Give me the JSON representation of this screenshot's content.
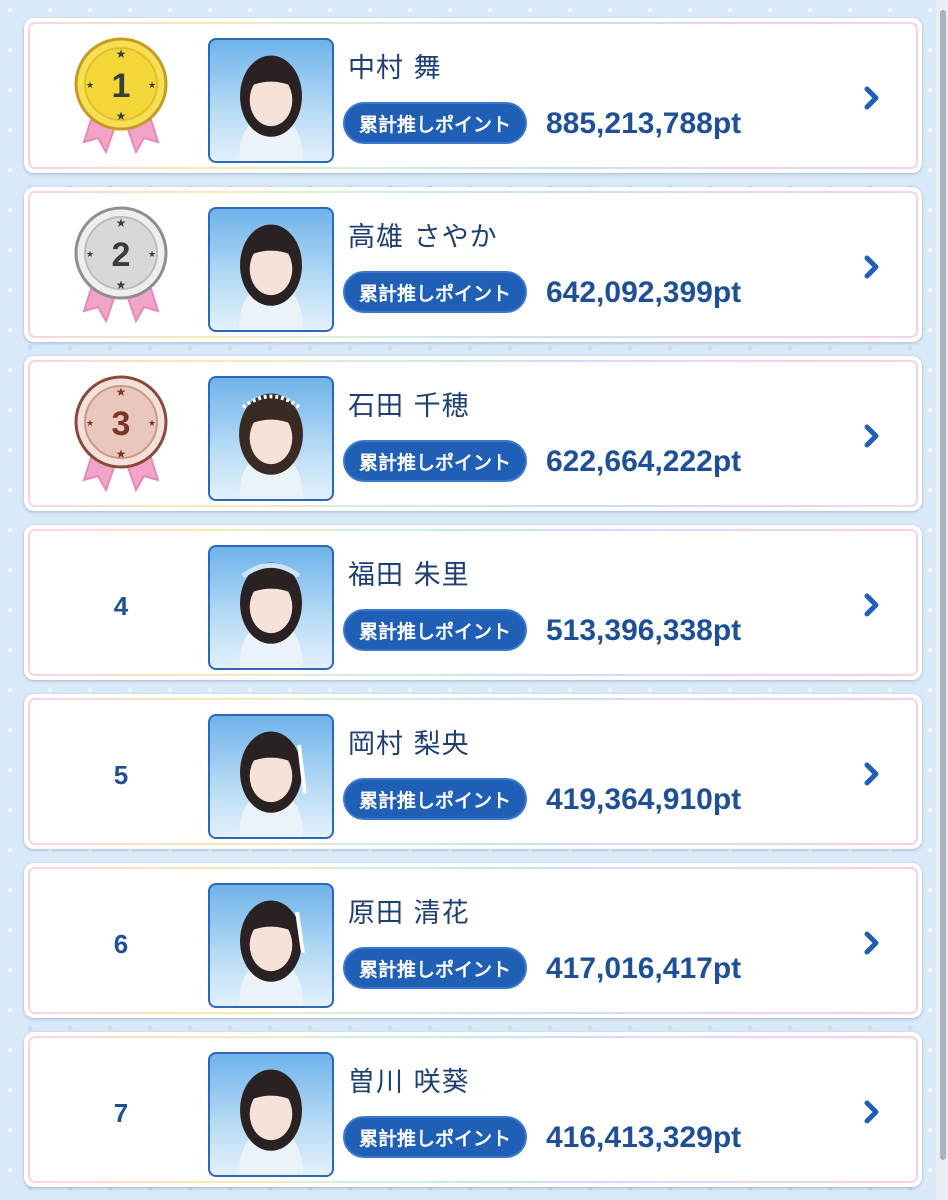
{
  "badge_label": "累計推しポイント",
  "colors": {
    "accent": "#1f5fb6",
    "text": "#1f4f97",
    "gold": "#f3d638",
    "silver": "#d8d8d8",
    "bronze": "#e9c7bd",
    "ribbon": "#f2a3c8"
  },
  "entries": [
    {
      "rank": "1",
      "name": "中村 舞",
      "points": "885,213,788pt",
      "medal": "gold"
    },
    {
      "rank": "2",
      "name": "高雄 さやか",
      "points": "642,092,399pt",
      "medal": "silver"
    },
    {
      "rank": "3",
      "name": "石田 千穂",
      "points": "622,664,222pt",
      "medal": "bronze"
    },
    {
      "rank": "4",
      "name": "福田 朱里",
      "points": "513,396,338pt",
      "medal": null
    },
    {
      "rank": "5",
      "name": "岡村 梨央",
      "points": "419,364,910pt",
      "medal": null
    },
    {
      "rank": "6",
      "name": "原田 清花",
      "points": "417,016,417pt",
      "medal": null
    },
    {
      "rank": "7",
      "name": "曽川 咲葵",
      "points": "416,413,329pt",
      "medal": null
    }
  ]
}
